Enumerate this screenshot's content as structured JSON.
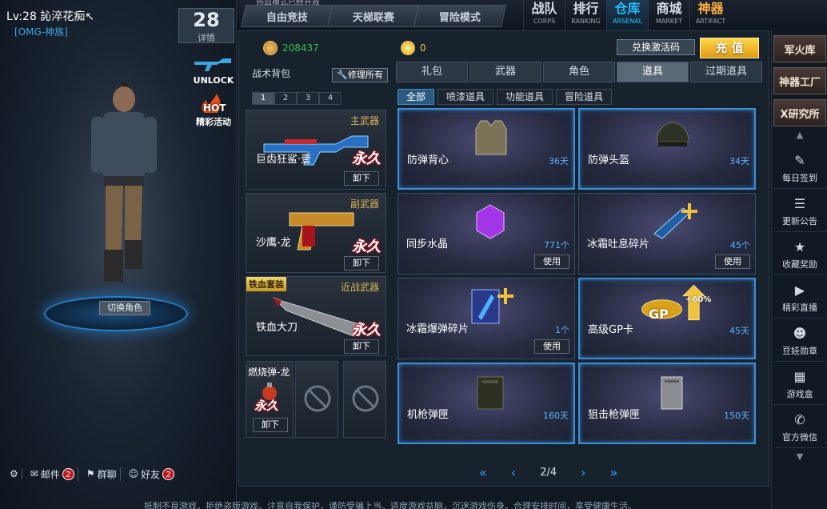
{
  "player": {
    "level_text": "Lv:28 訫淬花痴↖",
    "clan": "[OMG-神族]",
    "level_number": "28",
    "detail_label": "详情"
  },
  "badges": [
    {
      "label": "UNLOCK"
    },
    {
      "label": "精彩活动",
      "tag": "HOT"
    }
  ],
  "character": {
    "switch_label": "切换角色"
  },
  "bottom_bar": {
    "mail_label": "邮件",
    "mail_count": "2",
    "group_label": "群聊",
    "friends_label": "好友",
    "friends_count": "2"
  },
  "modes": [
    "自由竞技",
    "天梯联赛",
    "冒险模式"
  ],
  "mode_top_text": "热血模式已经开放",
  "nav_tabs": [
    {
      "cn": "战队",
      "en": "CORPS"
    },
    {
      "cn": "排行",
      "en": "RANKING"
    },
    {
      "cn": "仓库",
      "en": "ARSENAL",
      "active": true
    },
    {
      "cn": "商城",
      "en": "MARKET"
    },
    {
      "cn": "神器",
      "en": "ARTIFACT"
    }
  ],
  "currency": {
    "coins": "208437",
    "gold": "0",
    "redeem_label": "兑换激活码",
    "recharge_label": "充 值"
  },
  "backpack": {
    "title": "战术背包",
    "repair_label": "修理所有",
    "pages": [
      "1",
      "2",
      "3",
      "4"
    ],
    "active_page": "1"
  },
  "slots": [
    {
      "category": "主武器",
      "name": "巨齿狂鲨·壹",
      "perm": "永久",
      "unload": "卸下"
    },
    {
      "category": "副武器",
      "name": "沙鹰-龙",
      "perm": "永久",
      "unload": "卸下"
    },
    {
      "category": "近战武器",
      "name": "铁血大刀",
      "perm": "永久",
      "unload": "卸下",
      "set_badge": "铁血套装"
    },
    {
      "name": "燃烧弹-龙",
      "perm": "永久",
      "unload": "卸下"
    }
  ],
  "tabs_primary": [
    "礼包",
    "武器",
    "角色",
    "道具",
    "过期道具"
  ],
  "tabs_primary_active": "道具",
  "tabs_secondary": [
    "全部",
    "喷漆道具",
    "功能道具",
    "冒险道具"
  ],
  "tabs_secondary_active": "全部",
  "items": [
    {
      "name": "防弹背心",
      "duration": "36天",
      "selected": true
    },
    {
      "name": "防弹头盔",
      "duration": "34天",
      "selected": true
    },
    {
      "name": "同步水晶",
      "duration": "771个",
      "use": "使用"
    },
    {
      "name": "冰霜吐息碎片",
      "duration": "45个",
      "use": "使用"
    },
    {
      "name": "冰霜爆弹碎片",
      "duration": "1个",
      "use": "使用"
    },
    {
      "name": "高级GP卡",
      "duration": "45天",
      "selected": true,
      "art_text": "GP",
      "art_percent": "+60%"
    },
    {
      "name": "机枪弹匣",
      "duration": "160天",
      "selected": true
    },
    {
      "name": "狙击枪弹匣",
      "duration": "150天",
      "selected": true
    }
  ],
  "pagination": {
    "text": "2/4"
  },
  "right_sidebar": {
    "buttons": [
      "军火库",
      "神器工厂",
      "X研究所"
    ],
    "items": [
      "每日签到",
      "更新公告",
      "收藏奖励",
      "精彩直播",
      "豆娃勋章",
      "游戏盒",
      "官方微信"
    ]
  },
  "ticker": "抵制不良游戏，拒绝盗版游戏。注意自我保护，谨防受骗上当。适度游戏益脑，沉迷游戏伤身。合理安排时间，享受健康生活。",
  "colors": {
    "accent": "#25c0ff",
    "selected_border": "#3b8fd6",
    "perm_glow": "#c2161f",
    "gold": "#e8c64a",
    "coin_text": "#32c24a"
  }
}
